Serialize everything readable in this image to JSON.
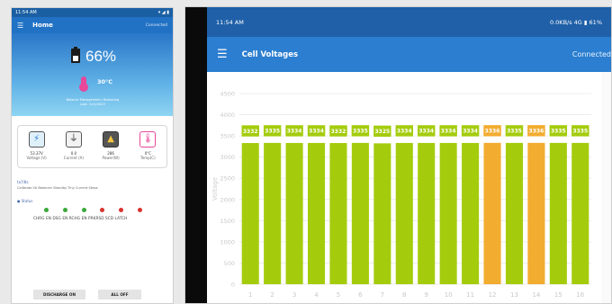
{
  "left_phone": {
    "status_time": "11:54 AM",
    "status_icons": "▾ ◢ ▮",
    "title": "Home",
    "connection": "Connected",
    "soc": "66%",
    "temperature": "30°C",
    "hero_info_1": "Balance Management / Balancing",
    "hero_info_2": "Last: 11/1/2023",
    "tiles": [
      {
        "value": "53.37V",
        "label": "Voltage (V)",
        "icon": "lightning-icon"
      },
      {
        "value": "0.0",
        "label": "Current (A)",
        "icon": "plug-icon"
      },
      {
        "value": "286",
        "label": "Power(W)",
        "icon": "power-icon"
      },
      {
        "value": "0°C",
        "label": "Temp(C)",
        "icon": "thermometer-icon"
      }
    ],
    "info_line": "ta7/8s",
    "info_sub": "Calibrate Vb Balancer Standby Tiny Current Steps",
    "status_label": "● Status",
    "dot_colors": [
      "#3aa83a",
      "#3aa83a",
      "#3aa83a",
      "#d8332e",
      "#d8332e",
      "#d8332e"
    ],
    "dot_labels": "CHRG EN  DSG EN  RCHG EN  PRKRSD  SCD LATCH",
    "discharge_button": "DISCHARGE ON",
    "all_off_button": "ALL OFF"
  },
  "right_phone": {
    "status_time": "11:54 AM",
    "status_right": "0.0KB/s  4G  ▮  61%",
    "title": "Cell Voltages",
    "connection": "Connected"
  },
  "chart_data": {
    "type": "bar",
    "categories": [
      "1",
      "2",
      "3",
      "4",
      "5",
      "6",
      "7",
      "8",
      "9",
      "10",
      "11",
      "12",
      "13",
      "14",
      "15",
      "16"
    ],
    "values": [
      3332,
      3335,
      3334,
      3334,
      3332,
      3335,
      3325,
      3334,
      3334,
      3334,
      3334,
      3336,
      3335,
      3336,
      3335,
      3335
    ],
    "ylim": [
      0,
      4500
    ],
    "yticks": [
      0,
      500,
      1000,
      1500,
      2000,
      2500,
      3000,
      3500,
      4000,
      4500
    ],
    "ylabel": "Voltage",
    "xlabel": "",
    "title": "",
    "colors": {
      "normal": "#a4cc0d",
      "highlight": "#f2ac30",
      "label_bg": "#a4cc0d",
      "label_text": "#ffffff"
    },
    "highlight_categories": [
      "12",
      "14"
    ],
    "grid": true
  }
}
